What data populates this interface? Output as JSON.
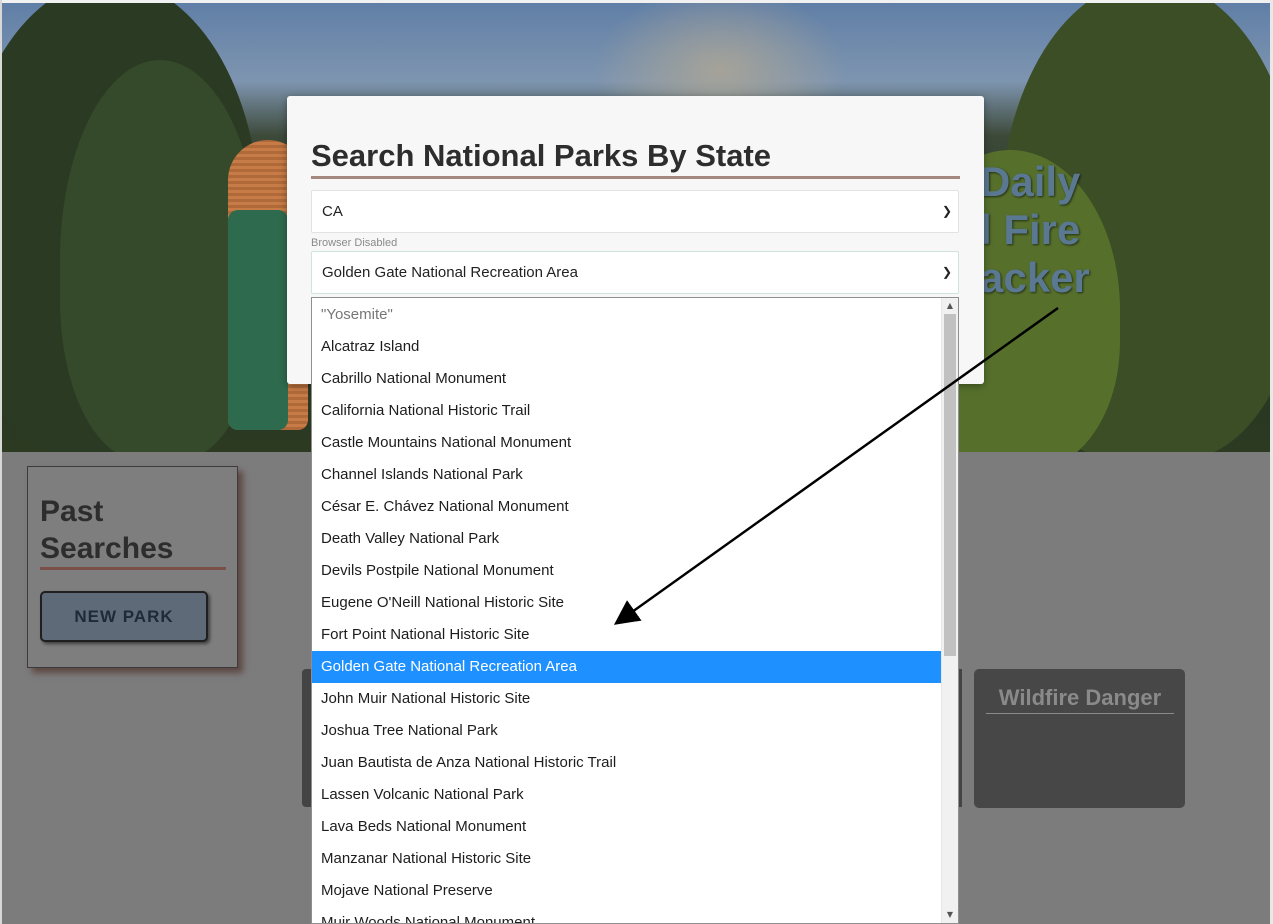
{
  "hero": {
    "title_lines": [
      "Daily",
      "l Fire",
      "acker"
    ]
  },
  "modal": {
    "title": "Search National Parks By State",
    "state_value": "CA",
    "hint": "Browser Disabled",
    "park_value": "Golden Gate National Recreation Area"
  },
  "dropdown": {
    "options": [
      "\"Yosemite\"",
      "Alcatraz Island",
      "Cabrillo National Monument",
      "California National Historic Trail",
      "Castle Mountains National Monument",
      "Channel Islands National Park",
      "César E. Chávez National Monument",
      "Death Valley National Park",
      "Devils Postpile National Monument",
      "Eugene O'Neill National Historic Site",
      "Fort Point National Historic Site",
      "Golden Gate National Recreation Area",
      "John Muir National Historic Site",
      "Joshua Tree National Park",
      "Juan Bautista de Anza National Historic Trail",
      "Lassen Volcanic National Park",
      "Lava Beds National Monument",
      "Manzanar National Historic Site",
      "Mojave National Preserve",
      "Muir Woods National Monument"
    ],
    "selected_index": 11
  },
  "past_searches": {
    "title": "Past Searches",
    "button_label": "NEW PARK"
  },
  "wildfire": {
    "title": "Wildfire Danger"
  },
  "colors": {
    "selected_option": "#1e90ff",
    "modal_bg": "#f7f7f7",
    "title_underline": "#a48880"
  }
}
